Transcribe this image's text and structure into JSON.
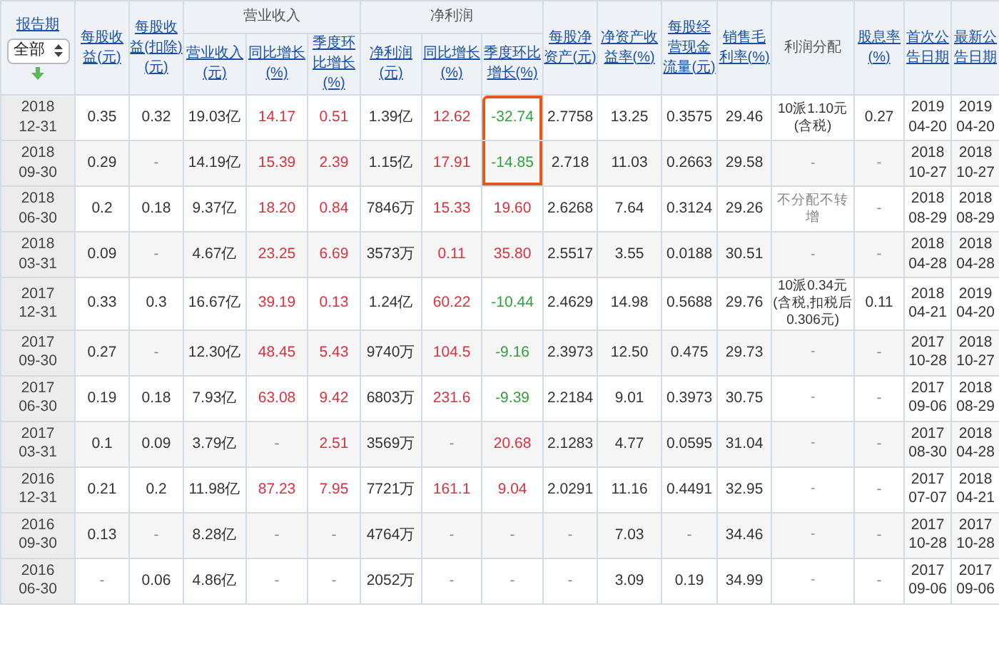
{
  "table": {
    "period_filter": {
      "label": "报告期",
      "value": "全部"
    },
    "header": [
      {
        "label": "每股收益(元)",
        "linked": true
      },
      {
        "label": "每股收益(扣除)(元)",
        "linked": true
      },
      {
        "label": "营业收入",
        "linked": false,
        "children": [
          {
            "label": "营业收入(元)",
            "linked": true,
            "signed": false,
            "highlighted": false
          },
          {
            "label": "同比增长(%)",
            "linked": true,
            "signed": true,
            "highlighted": false
          },
          {
            "label": "季度环比增长(%)",
            "linked": true,
            "signed": true,
            "highlighted": false
          }
        ]
      },
      {
        "label": "净利润",
        "linked": false,
        "children": [
          {
            "label": "净利润(元)",
            "linked": true,
            "signed": false,
            "highlighted": false
          },
          {
            "label": "同比增长(%)",
            "linked": true,
            "signed": true,
            "highlighted": false
          },
          {
            "label": "季度环比增长(%)",
            "linked": true,
            "signed": true,
            "highlighted": true
          }
        ]
      },
      {
        "label": "每股净资产(元)",
        "linked": true
      },
      {
        "label": "净资产收益率(%)",
        "linked": true
      },
      {
        "label": "每股经营现金流量(元)",
        "linked": true
      },
      {
        "label": "销售毛利率(%)",
        "linked": true
      },
      {
        "label": "利润分配",
        "linked": false
      },
      {
        "label": "股息率(%)",
        "linked": true
      },
      {
        "label": "首次公告日期",
        "linked": true
      },
      {
        "label": "最新公告日期",
        "linked": true
      }
    ],
    "rows": [
      {
        "highlighted": true,
        "cells": [
          "2018\n12-31",
          "0.35",
          "0.32",
          "19.03亿",
          "14.17",
          "0.51",
          "1.39亿",
          "12.62",
          "-32.74",
          "2.7758",
          "13.25",
          "0.3575",
          "29.46",
          "10派1.10元\n(含税)",
          "0.27",
          "2019\n04-20",
          "2019\n04-20"
        ]
      },
      {
        "highlighted": true,
        "cells": [
          "2018\n09-30",
          "0.29",
          "-",
          "14.19亿",
          "15.39",
          "2.39",
          "1.15亿",
          "17.91",
          "-14.85",
          "2.718",
          "11.03",
          "0.2663",
          "29.58",
          "-",
          "-",
          "2018\n10-27",
          "2018\n10-27"
        ]
      },
      {
        "highlighted": false,
        "cells": [
          "2018\n06-30",
          "0.2",
          "0.18",
          "9.37亿",
          "18.20",
          "0.84",
          "7846万",
          "15.33",
          "19.60",
          "2.6268",
          "7.64",
          "0.3124",
          "29.26",
          "不分配不转增",
          "-",
          "2018\n08-29",
          "2018\n08-29"
        ]
      },
      {
        "highlighted": false,
        "cells": [
          "2018\n03-31",
          "0.09",
          "-",
          "4.67亿",
          "23.25",
          "6.69",
          "3573万",
          "0.11",
          "35.80",
          "2.5517",
          "3.55",
          "0.0188",
          "30.51",
          "-",
          "-",
          "2018\n04-28",
          "2018\n04-28"
        ]
      },
      {
        "highlighted": false,
        "cells": [
          "2017\n12-31",
          "0.33",
          "0.3",
          "16.67亿",
          "39.19",
          "0.13",
          "1.24亿",
          "60.22",
          "-10.44",
          "2.4629",
          "14.98",
          "0.5688",
          "29.76",
          "10派0.34元\n(含税,扣税后\n0.306元)",
          "0.11",
          "2018\n04-21",
          "2019\n04-20"
        ]
      },
      {
        "highlighted": false,
        "cells": [
          "2017\n09-30",
          "0.27",
          "-",
          "12.30亿",
          "48.45",
          "5.43",
          "9740万",
          "104.5",
          "-9.16",
          "2.3973",
          "12.50",
          "0.475",
          "29.73",
          "-",
          "-",
          "2017\n10-28",
          "2018\n10-27"
        ]
      },
      {
        "highlighted": false,
        "cells": [
          "2017\n06-30",
          "0.19",
          "0.18",
          "7.93亿",
          "63.08",
          "9.42",
          "6803万",
          "231.6",
          "-9.39",
          "2.2184",
          "9.01",
          "0.3973",
          "30.75",
          "-",
          "-",
          "2017\n09-06",
          "2018\n08-29"
        ]
      },
      {
        "highlighted": false,
        "cells": [
          "2017\n03-31",
          "0.1",
          "0.09",
          "3.79亿",
          "-",
          "2.51",
          "3569万",
          "-",
          "20.68",
          "2.1283",
          "4.77",
          "0.0595",
          "31.04",
          "-",
          "-",
          "2017\n08-30",
          "2018\n04-28"
        ]
      },
      {
        "highlighted": false,
        "cells": [
          "2016\n12-31",
          "0.21",
          "0.2",
          "11.98亿",
          "87.23",
          "7.95",
          "7721万",
          "161.1",
          "9.04",
          "2.0291",
          "11.16",
          "0.4491",
          "32.95",
          "-",
          "-",
          "2017\n07-07",
          "2018\n04-21"
        ]
      },
      {
        "highlighted": false,
        "cells": [
          "2016\n09-30",
          "0.13",
          "-",
          "8.28亿",
          "-",
          "-",
          "4764万",
          "-",
          "-",
          "-",
          "7.03",
          "-",
          "34.46",
          "-",
          "-",
          "2017\n10-28",
          "2017\n10-28"
        ]
      },
      {
        "highlighted": false,
        "cells": [
          "2016\n06-30",
          "-",
          "0.06",
          "4.86亿",
          "-",
          "-",
          "2052万",
          "-",
          "-",
          "-",
          "3.09",
          "0.19",
          "34.99",
          "-",
          "-",
          "2017\n09-06",
          "2017\n09-06"
        ]
      }
    ]
  }
}
